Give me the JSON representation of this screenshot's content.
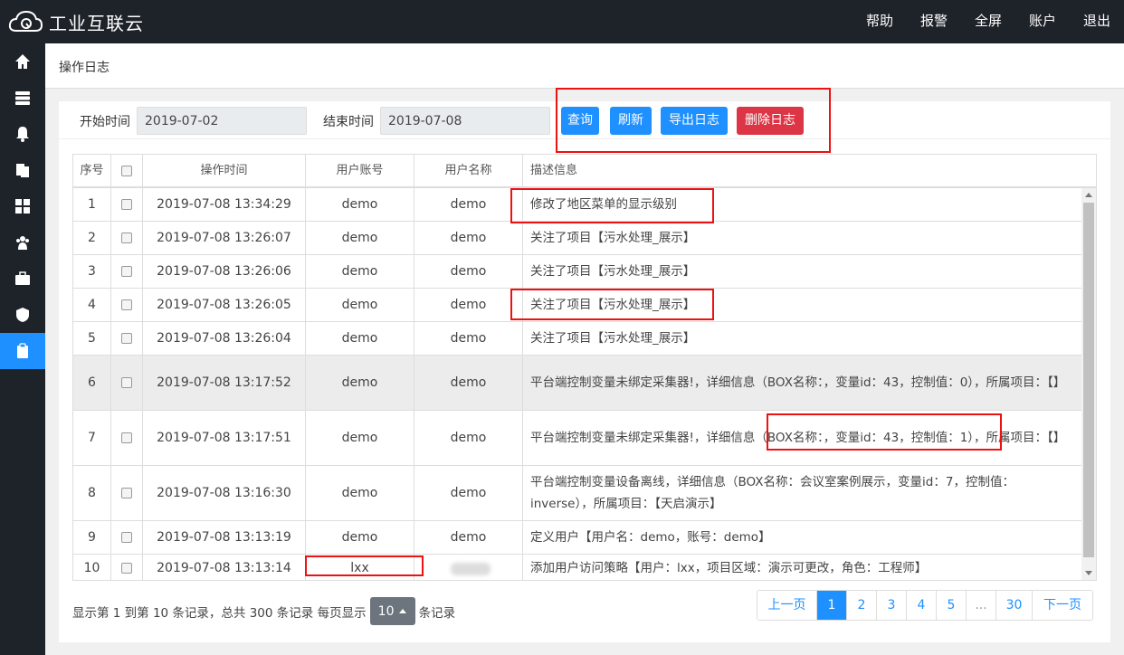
{
  "app": {
    "title": "工业互联云"
  },
  "topnav": [
    "帮助",
    "报警",
    "全屏",
    "账户",
    "退出"
  ],
  "sidebar": {
    "items": [
      {
        "icon": "home-icon",
        "active": false
      },
      {
        "icon": "server-icon",
        "active": false
      },
      {
        "icon": "bell-icon",
        "active": false
      },
      {
        "icon": "copy-icon",
        "active": false
      },
      {
        "icon": "grid-icon",
        "active": false
      },
      {
        "icon": "users-icon",
        "active": false
      },
      {
        "icon": "briefcase-icon",
        "active": false
      },
      {
        "icon": "shield-icon",
        "active": false
      },
      {
        "icon": "clipboard-icon",
        "active": true
      }
    ]
  },
  "page": {
    "title": "操作日志"
  },
  "filter": {
    "start_label": "开始时间",
    "start_value": "2019-07-02",
    "end_label": "结束时间",
    "end_value": "2019-07-08",
    "buttons": {
      "query": "查询",
      "refresh": "刷新",
      "export": "导出日志",
      "delete": "删除日志"
    }
  },
  "table": {
    "columns": [
      "序号",
      "",
      "操作时间",
      "用户账号",
      "用户名称",
      "描述信息"
    ],
    "rows": [
      {
        "no": "1",
        "time": "2019-07-08 13:34:29",
        "account": "demo",
        "name": "demo",
        "desc": "修改了地区菜单的显示级别"
      },
      {
        "no": "2",
        "time": "2019-07-08 13:26:07",
        "account": "demo",
        "name": "demo",
        "desc": "关注了项目【污水处理_展示】"
      },
      {
        "no": "3",
        "time": "2019-07-08 13:26:06",
        "account": "demo",
        "name": "demo",
        "desc": "关注了项目【污水处理_展示】"
      },
      {
        "no": "4",
        "time": "2019-07-08 13:26:05",
        "account": "demo",
        "name": "demo",
        "desc": "关注了项目【污水处理_展示】"
      },
      {
        "no": "5",
        "time": "2019-07-08 13:26:04",
        "account": "demo",
        "name": "demo",
        "desc": "关注了项目【污水处理_展示】"
      },
      {
        "no": "6",
        "time": "2019-07-08 13:17:52",
        "account": "demo",
        "name": "demo",
        "desc": "平台端控制变量未绑定采集器!，详细信息（BOX名称：，变量id：43，控制值：0），所属项目：【】"
      },
      {
        "no": "7",
        "time": "2019-07-08 13:17:51",
        "account": "demo",
        "name": "demo",
        "desc": "平台端控制变量未绑定采集器!，详细信息（BOX名称：，变量id：43，控制值：1），所属项目：【】"
      },
      {
        "no": "8",
        "time": "2019-07-08 13:16:30",
        "account": "demo",
        "name": "demo",
        "desc": "平台端控制变量设备离线，详细信息（BOX名称：会议室案例展示，变量id：7，控制值：inverse），所属项目：【天启演示】"
      },
      {
        "no": "9",
        "time": "2019-07-08 13:13:19",
        "account": "demo",
        "name": "demo",
        "desc": "定义用户【用户名：demo，账号：demo】"
      },
      {
        "no": "10",
        "time": "2019-07-08 13:13:14",
        "account": "lxx",
        "name": "",
        "desc": "添加用户访问策略【用户：lxx，项目区域：演示可更改，角色：工程师】"
      }
    ]
  },
  "footer": {
    "summary_prefix": "显示第 1 到第 10 条记录，总共 300 条记录 每页显示",
    "page_size": "10",
    "summary_suffix": "条记录"
  },
  "pagination": {
    "prev": "上一页",
    "pages": [
      "1",
      "2",
      "3",
      "4",
      "5",
      "...",
      "30"
    ],
    "active": "1",
    "next": "下一页"
  }
}
